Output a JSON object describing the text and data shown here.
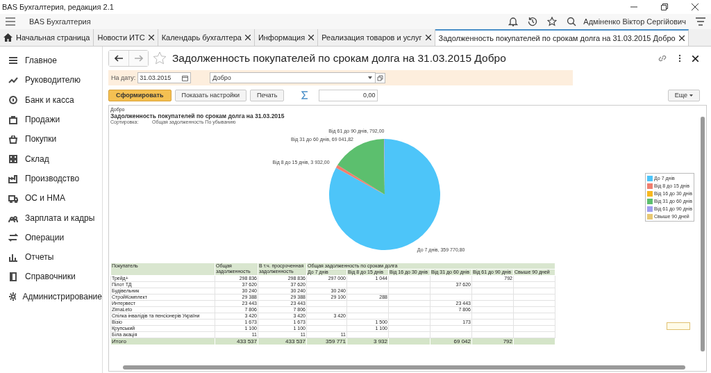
{
  "window": {
    "title": "BAS Бухгалтерия, редакция 2.1"
  },
  "app_bar": {
    "title": "BAS Бухгалтерия",
    "user": "Адміненко Віктор Сергійович"
  },
  "tabs": [
    {
      "label": "Начальная страница",
      "kind": "home",
      "selected": false
    },
    {
      "label": "Новости ИТС",
      "kind": "page",
      "selected": false
    },
    {
      "label": "Календарь бухгалтера",
      "kind": "page",
      "selected": false
    },
    {
      "label": "Информация",
      "kind": "page",
      "selected": false
    },
    {
      "label": "Реализация товаров и услуг",
      "kind": "page",
      "selected": false
    },
    {
      "label": "Задолженность покупателей по срокам долга на 31.03.2015 Добро",
      "kind": "page",
      "selected": true
    }
  ],
  "sidebar": {
    "items": [
      {
        "label": "Главное"
      },
      {
        "label": "Руководителю"
      },
      {
        "label": "Банк и касса"
      },
      {
        "label": "Продажи"
      },
      {
        "label": "Покупки"
      },
      {
        "label": "Склад"
      },
      {
        "label": "Производство"
      },
      {
        "label": "ОС и НМА"
      },
      {
        "label": "Зарплата и кадры"
      },
      {
        "label": "Операции"
      },
      {
        "label": "Отчеты"
      },
      {
        "label": "Справочники"
      },
      {
        "label": "Администрирование"
      }
    ]
  },
  "form": {
    "title": "Задолженность покупателей по срокам долга на 31.03.2015 Добро",
    "date_label": "На дату:",
    "date_value": "31.03.2015",
    "organization": "Добро",
    "buttons": [
      {
        "label": "Сформировать",
        "kind": "primary"
      },
      {
        "label": "Показать настройки",
        "kind": "default"
      },
      {
        "label": "Печать",
        "kind": "default"
      }
    ],
    "sum_value": "0,00",
    "more_button": "Еще"
  },
  "report": {
    "organization": "Добро",
    "title": "Задолженность покупателей по срокам долга на 31.03.2015",
    "sort_label": "Сортировка:",
    "sort_value": "Общая задолженность По убыванию",
    "chart_data": {
      "type": "pie",
      "categories": [
        "До 7 днів",
        "Від 8 до 15 днів",
        "Від 16 до 30 днів",
        "Від 31 до 60 днів",
        "Від 61 до 90 днів",
        "Свыше 90 дней"
      ],
      "values": [
        359770.8,
        3932,
        0,
        69041.82,
        792,
        0
      ],
      "colors": [
        "#4dc5f9",
        "#f07e6e",
        "#f8b81f",
        "#5cbf6e",
        "#9e9ef0",
        "#e8c873"
      ],
      "value_labels": [
        "До 7 днів, 359 770,80",
        "Від 8 до 15 днів, 3 932,00",
        null,
        "Від 31 до 60 днів, 69 041,82",
        "Від 61 до 90 днів, 792,00",
        null
      ],
      "legend": "right"
    },
    "table": {
      "group_header": "Общая задолженность по срокам долга",
      "columns": [
        "Покупатель",
        "Общая задолженность",
        "В т.ч. просроченная задолженность",
        "До 7 днів",
        "Від 8 до 15 днів",
        "Від 16 до 30 днів",
        "Від 31 до 60 днів",
        "Від 61 до 90 днів",
        "Свыше 90 дней"
      ],
      "rows": [
        {
          "cells": [
            "Трейд+",
            "298 836",
            "298 836",
            "297 000",
            "1 044",
            "",
            "",
            "792",
            ""
          ]
        },
        {
          "cells": [
            "Пілот ТД",
            "37 620",
            "37 620",
            "",
            "",
            "",
            "37 620",
            "",
            ""
          ]
        },
        {
          "cells": [
            "Будівельник",
            "30 240",
            "30 240",
            "30 240",
            "",
            "",
            "",
            "",
            ""
          ]
        },
        {
          "cells": [
            "СтройКомплект",
            "29 388",
            "29 388",
            "29 100",
            "288",
            "",
            "",
            "",
            ""
          ]
        },
        {
          "cells": [
            "Интервест",
            "23 443",
            "23 443",
            "",
            "",
            "",
            "23 443",
            "",
            ""
          ]
        },
        {
          "cells": [
            "ZimaLeto",
            "7 806",
            "7 806",
            "",
            "",
            "",
            "7 806",
            "",
            ""
          ]
        },
        {
          "cells": [
            "Спілка інвалідів та пенсіонерів України",
            "3 420",
            "3 420",
            "3 420",
            "",
            "",
            "",
            "",
            ""
          ]
        },
        {
          "cells": [
            "Візіо",
            "1 673",
            "1 673",
            "",
            "1 500",
            "",
            "173",
            "",
            ""
          ]
        },
        {
          "cells": [
            "Крупський",
            "1 100",
            "1 100",
            "",
            "1 100",
            "",
            "",
            "",
            ""
          ]
        },
        {
          "cells": [
            "Біла акація",
            "11",
            "11",
            "11",
            "",
            "",
            "",
            "",
            ""
          ]
        }
      ],
      "total": {
        "cells": [
          "Итого",
          "433 537",
          "433 537",
          "359 771",
          "3 932",
          "",
          "69 042",
          "792",
          ""
        ]
      }
    }
  }
}
